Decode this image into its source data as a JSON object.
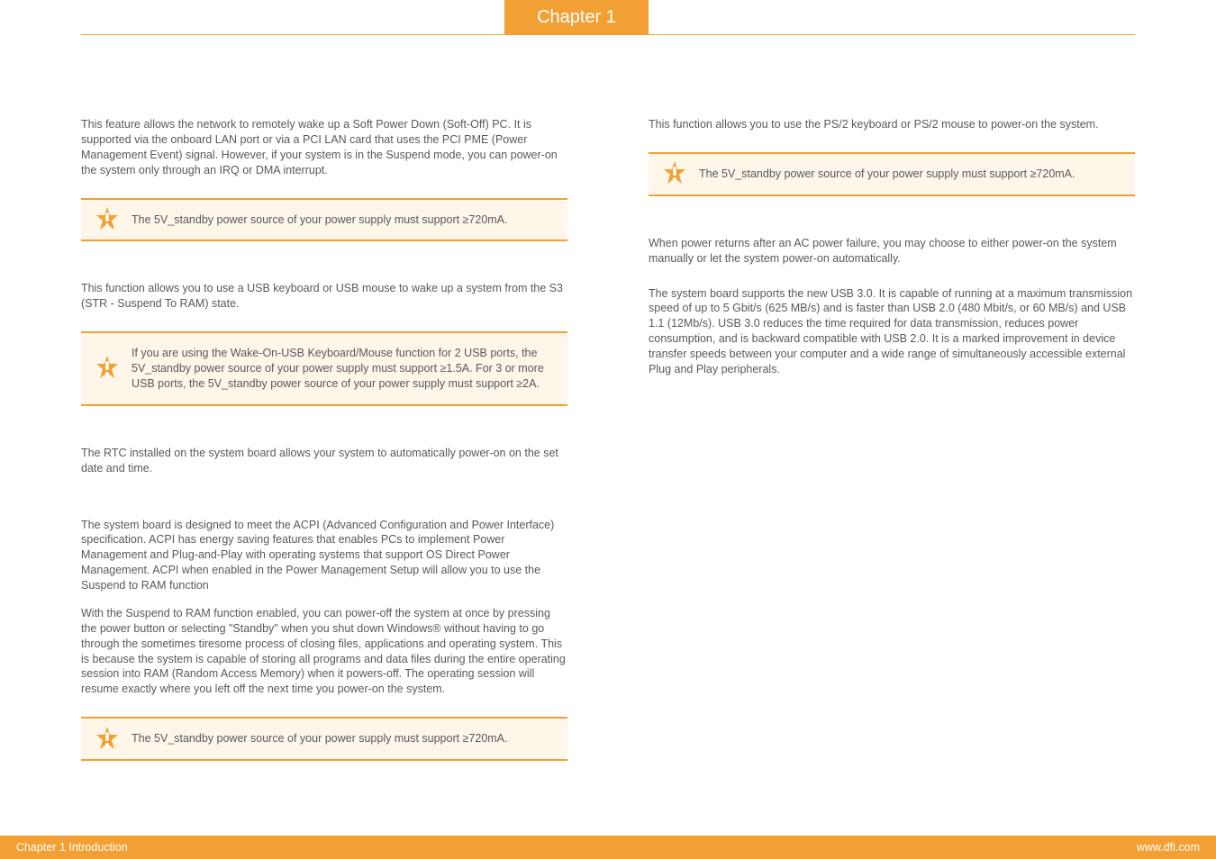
{
  "chapter_tab": "Chapter 1",
  "left": {
    "p1": "This feature allows the network to remotely wake up a Soft Power Down (Soft-Off) PC. It is supported via the onboard LAN port or via a PCI LAN card that uses the PCI PME (Power Management Event) signal. However, if your system is in the Suspend mode, you can power-on the system only through an IRQ or DMA interrupt.",
    "note1": "The 5V_standby power source of your power supply must support ≥720mA.",
    "p2": "This function allows you to use a USB keyboard or USB mouse to wake up a system from the S3 (STR - Suspend To RAM) state.",
    "note2": "If you are using the Wake-On-USB Keyboard/Mouse function for 2 USB ports, the 5V_standby power source of your power supply must support ≥1.5A. For 3 or more USB ports, the 5V_standby power source of your power supply must support ≥2A.",
    "p3": "The RTC installed on the system board allows your system to automatically power-on on the set date and time.",
    "p4": "The system board is designed to meet the ACPI (Advanced Configuration and Power Interface) specification. ACPI has energy saving features that enables PCs to implement Power Management and Plug-and-Play with operating systems that support OS Direct Power Management. ACPI when enabled in the Power Management Setup will allow you to use the Suspend to RAM function",
    "p5": "With the Suspend to RAM function enabled, you can power-off the system at once by pressing the power button or selecting \"Standby\" when you shut down Windows® without having to go through the sometimes tiresome process of closing files, applications and operating system. This is because the system is capable of storing all programs and data files during the entire operating session into RAM (Random Access Memory) when it powers-off. The operating session will resume exactly where you left off the next time you power-on the system.",
    "note3": "The 5V_standby power source of your power supply must support ≥720mA."
  },
  "right": {
    "p1": "This function allows you to use the PS/2 keyboard or PS/2 mouse to power-on the system.",
    "note1": "The 5V_standby power source of your power supply must support ≥720mA.",
    "p2": "When power returns after an AC power failure, you may choose to either power-on the system manually or let the system power-on automatically.",
    "p3": "The system board supports the new USB 3.0. It is capable of running at a maximum transmission speed of up to 5 Gbit/s (625 MB/s) and is faster than USB 2.0 (480 Mbit/s, or 60 MB/s) and USB 1.1 (12Mb/s). USB 3.0 reduces the time required for data transmission, reduces power consumption, and is backward compatible with USB 2.0. It is  a marked  improvement  in  device  transfer  speeds  between  your  computer  and  a wide range of simultaneously accessible external Plug and Play peripherals."
  },
  "footer": {
    "left": "Chapter 1 Introduction",
    "right": "www.dfi.com"
  },
  "icons": {
    "important": "important-icon"
  }
}
